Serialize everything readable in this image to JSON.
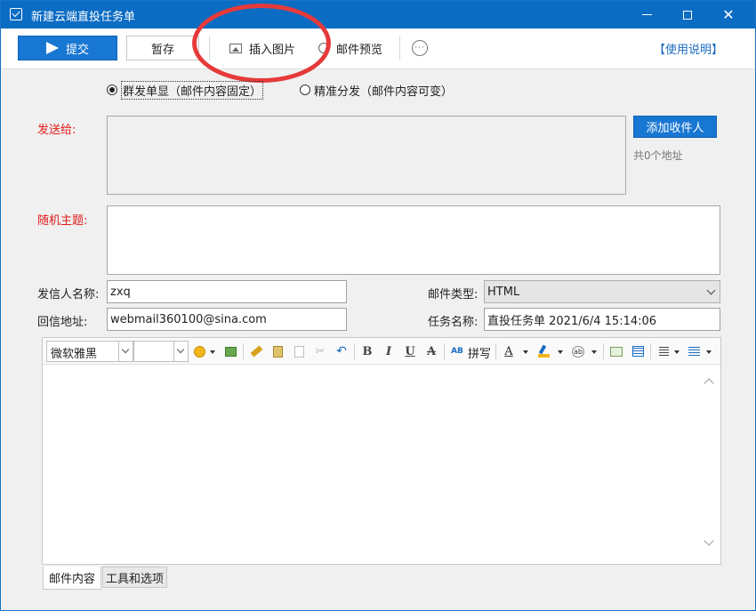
{
  "window": {
    "title": "新建云端直投任务单"
  },
  "toolbar": {
    "submit_label": "提交",
    "save_label": "暂存",
    "insert_image_label": "插入图片",
    "preview_label": "邮件预览",
    "more_label": "···",
    "help_label": "【使用说明】"
  },
  "send_mode": {
    "options": [
      {
        "label": "群发单显（邮件内容固定）",
        "checked": true
      },
      {
        "label": "精准分发（邮件内容可变）",
        "checked": false
      }
    ]
  },
  "recipients": {
    "label": "发送给:",
    "add_button_label": "添加收件人",
    "count_text": "共0个地址"
  },
  "subject": {
    "label": "随机主题:",
    "value": ""
  },
  "sender": {
    "name_label": "发信人名称:",
    "name_value": "zxq",
    "reply_label": "回信地址:",
    "reply_value": "webmail360100@sina.com",
    "mail_type_label": "邮件类型:",
    "mail_type_value": "HTML",
    "task_name_label": "任务名称:",
    "task_name_value": "直投任务单 2021/6/4 15:14:06"
  },
  "editor": {
    "font_value": "微软雅黑",
    "font_size_value": "",
    "spell_label": "拼写",
    "bold_glyph": "B",
    "italic_glyph": "I",
    "underline_glyph": "U",
    "strike_glyph": "A",
    "color_glyph": "A",
    "spell_icon_glyph": "AB",
    "fx_glyph": "ab",
    "body_text": ""
  },
  "tabs": [
    {
      "label": "邮件内容",
      "active": true
    },
    {
      "label": "工具和选项",
      "active": false
    }
  ],
  "colors": {
    "title_bar": "#0b6cc4",
    "primary_button": "#1877d2",
    "required_label": "#e01b1b",
    "annotation_oval": "#e63a3a",
    "link": "#1a6cc4"
  }
}
